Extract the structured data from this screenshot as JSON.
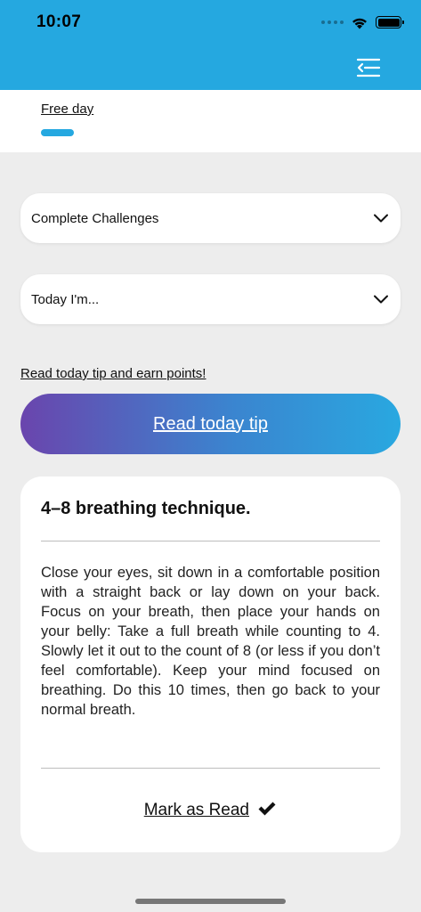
{
  "status_bar": {
    "time": "10:07"
  },
  "header": {
    "menu_icon": "menu-collapse-icon"
  },
  "tabs": {
    "free_day_label": "Free day"
  },
  "dropdowns": [
    {
      "label": "Complete Challenges",
      "icon": "chevron-down-icon"
    },
    {
      "label": "Today I'm...",
      "icon": "chevron-down-icon"
    }
  ],
  "tip_section": {
    "earn_link": "Read today tip and earn points!",
    "button_label": "Read today tip"
  },
  "tip_card": {
    "title": "4–8 breathing technique.",
    "body": "Close your eyes, sit down in a comfortable position with a straight back or lay down on your back. Focus on your breath, then place your hands on your belly: Take a full breath while counting to 4. Slowly let it out to the count of 8 (or less if you don’t feel comfortable). Keep your mind focused on breathing. Do this 10 times, then go back to your normal breath.",
    "mark_read_label": "Mark as Read",
    "mark_read_icon": "checkmark-icon"
  },
  "colors": {
    "brand": "#25a8e0",
    "gradient_start": "#6a45ad",
    "gradient_end": "#29a8e0",
    "background": "#ededed"
  }
}
